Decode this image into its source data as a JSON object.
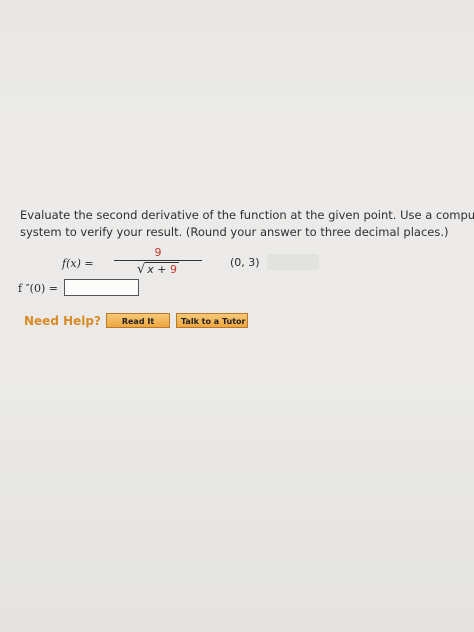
{
  "question": {
    "line1": "Evaluate the second derivative of the function at the given point. Use a computer algebr",
    "line2": "system to verify your result. (Round your answer to three decimal places.)"
  },
  "function": {
    "label": "f(x) =",
    "numerator": "9",
    "radical": "√",
    "radicand_x": "x + ",
    "radicand_const": "9",
    "point": "(0, 3)"
  },
  "answer": {
    "label_fn": "f ″(0) =",
    "value": ""
  },
  "help": {
    "label": "Need Help?",
    "read_it": "Read It",
    "talk_to_tutor": "Talk to a Tutor"
  },
  "colors": {
    "accent_orange": "#eea63d",
    "help_text": "#d98b24",
    "red_number": "#c0392b"
  }
}
